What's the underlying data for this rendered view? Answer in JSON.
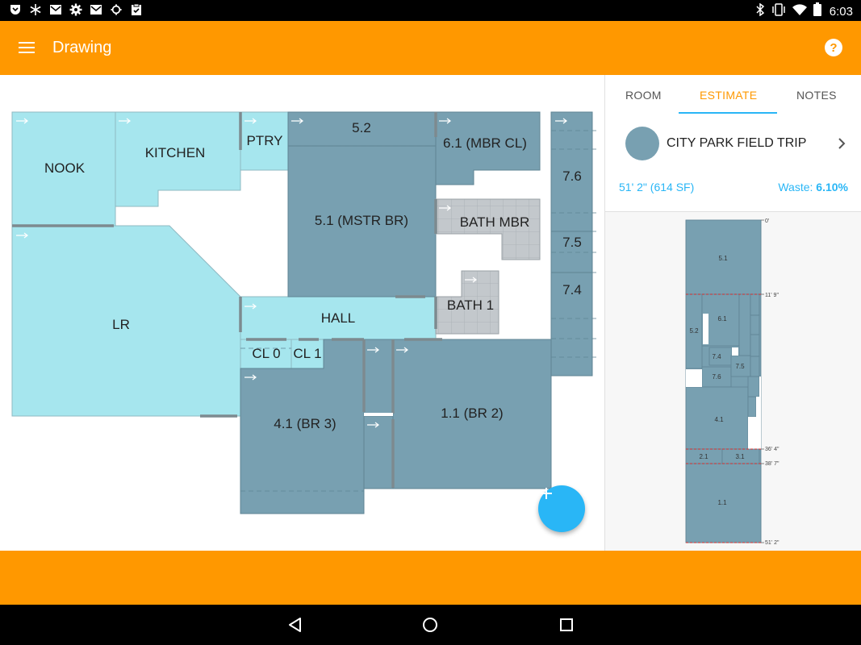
{
  "status_bar": {
    "time": "6:03",
    "left_icons": [
      "pocket-icon",
      "snowflake-icon",
      "gmail-icon",
      "settings-icon",
      "gmail-icon",
      "settings-icon",
      "clipboard-check-icon"
    ],
    "right_icons": [
      "bluetooth-icon",
      "vibrate-icon",
      "wifi-icon",
      "battery-icon"
    ]
  },
  "toolbar": {
    "title": "Drawing",
    "menu_icon": "hamburger-menu-icon",
    "help_icon": "help-circle-icon"
  },
  "floor_plan": {
    "room_labels": {
      "nook": "NOOK",
      "kitchen": "KITCHEN",
      "ptry": "PTRY",
      "r52": "5.2",
      "r61": "6.1 (MBR CL)",
      "r51": "5.1 (MSTR BR)",
      "bath_mbr": "BATH MBR",
      "r76": "7.6",
      "r75": "7.5",
      "r74": "7.4",
      "lr": "LR",
      "hall": "HALL",
      "bath1": "BATH 1",
      "cl0": "CL 0",
      "cl1": "CL 1",
      "r41": "4.1 (BR 3)",
      "r11": "1.1 (BR 2)"
    },
    "colors": {
      "light_room": "#a6e6ee",
      "dark_room": "#78a0b1",
      "bath_room": "#c3c8cc"
    }
  },
  "fab": {
    "label": "+",
    "icon": "add-icon"
  },
  "side_panel": {
    "tabs": [
      {
        "label": "ROOM",
        "active": false
      },
      {
        "label": "ESTIMATE",
        "active": true
      },
      {
        "label": "NOTES",
        "active": false
      }
    ],
    "project": {
      "name": "CITY PARK FIELD TRIP",
      "color": "#78a0b1"
    },
    "length_summary": "51' 2\" (614 SF)",
    "waste_label": "Waste:",
    "waste_value": "6.10%",
    "preview": {
      "labels": {
        "p51": "5.1",
        "p61": "6.1",
        "p52": "5.2",
        "p74": "7.4",
        "p75": "7.5",
        "p76": "7.6",
        "p41": "4.1",
        "p21": "2.1",
        "p31": "3.1",
        "p11": "1.1"
      },
      "ticks": {
        "t0": "0'",
        "t1": "11' 9\"",
        "t2": "36' 4\"",
        "t3": "38' 7\"",
        "t4": "51' 2\""
      }
    }
  },
  "nav_bar": {
    "icons": [
      "back-icon",
      "home-icon",
      "recents-icon"
    ]
  }
}
